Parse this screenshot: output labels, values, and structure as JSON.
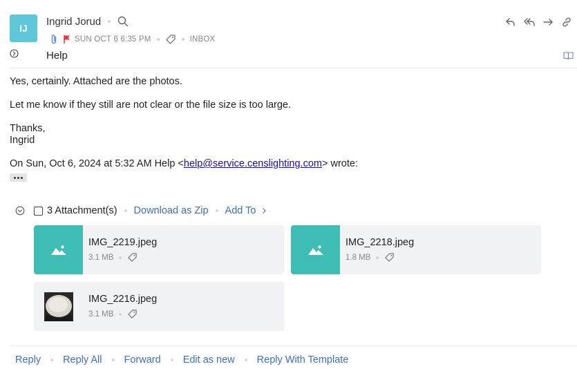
{
  "header": {
    "avatar_initials": "IJ",
    "sender_name": "Ingrid Jorud",
    "date": "SUN OCT 6 6:35 PM",
    "folder": "INBOX",
    "subject": "Help"
  },
  "body": {
    "line1": "Yes, certainly. Attached are the photos.",
    "line2": "Let me know if they still are not clear or the file size is too large.",
    "line3": "Thanks,",
    "line4": "Ingrid",
    "quote_prefix": "On Sun, Oct 6, 2024 at 5:32 AM Help <",
    "quote_email": "help@service.censlighting.com",
    "quote_suffix": "> wrote:"
  },
  "attachments": {
    "count_label": "3 Attachment(s)",
    "download_zip": "Download as Zip",
    "add_to": "Add To",
    "files": [
      {
        "name": "IMG_2219.jpeg",
        "size": "3.1 MB"
      },
      {
        "name": "IMG_2218.jpeg",
        "size": "1.8 MB"
      },
      {
        "name": "IMG_2216.jpeg",
        "size": "3.1 MB"
      }
    ]
  },
  "footer": {
    "reply": "Reply",
    "reply_all": "Reply All",
    "forward": "Forward",
    "edit_as_new": "Edit as new",
    "reply_template": "Reply With Template"
  },
  "colors": {
    "avatar": "#5ec8d8",
    "accent_link": "#3a6fc4",
    "thumb": "#3ebdb4",
    "flag": "#e03a3a",
    "attachment_clip": "#4a7fd4"
  }
}
